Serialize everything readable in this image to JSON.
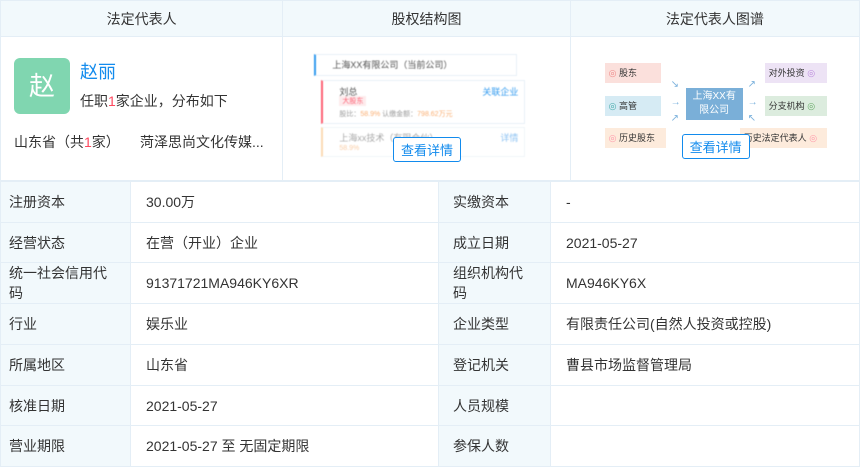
{
  "headers": [
    "法定代表人",
    "股权结构图",
    "法定代表人图谱"
  ],
  "rep": {
    "avatar_char": "赵",
    "name": "赵丽",
    "desc_pre": "任职",
    "desc_count": "1",
    "desc_post": "家企业，分布如下",
    "prov_pre": "山东省（共",
    "prov_count": "1",
    "prov_post": "家）",
    "company": "菏泽思尚文化传媒..."
  },
  "equity": {
    "company": "上海XX有限公司（当前公司）",
    "holder": "刘总",
    "related": "关联企业",
    "tag": "大股东",
    "ratio_label": "股比：",
    "ratio": "58.9%",
    "amount_label": "认缴金额：",
    "amount": "798.62万元",
    "sub": "上海xx技术（有限合伙）",
    "detail": "详情",
    "sub_ratio": "58.9%",
    "view": "查看详情"
  },
  "graph": {
    "center": "上海XX有限公司",
    "left": [
      "股东",
      "高管",
      "历史股东"
    ],
    "right": [
      "对外投资",
      "分支机构",
      "历史法定代表人"
    ],
    "view": "查看详情",
    "colors": {
      "shareholder": "#fbe0dc",
      "exec": "#d6ebf4",
      "hist": "#fdebdc",
      "invest": "#ede3f5",
      "branch": "#dcecde",
      "center": "#7aafd8"
    }
  },
  "rows": [
    [
      "注册资本",
      "30.00万",
      "实缴资本",
      "-"
    ],
    [
      "经营状态",
      "在营（开业）企业",
      "成立日期",
      "2021-05-27"
    ],
    [
      "统一社会信用代码",
      "91371721MA946KY6XR",
      "组织机构代码",
      "MA946KY6X"
    ],
    [
      "行业",
      "娱乐业",
      "企业类型",
      "有限责任公司(自然人投资或控股)"
    ],
    [
      "所属地区",
      "山东省",
      "登记机关",
      "曹县市场监督管理局"
    ],
    [
      "核准日期",
      "2021-05-27",
      "人员规模",
      ""
    ],
    [
      "营业期限",
      "2021-05-27 至 无固定期限",
      "参保人数",
      ""
    ]
  ]
}
